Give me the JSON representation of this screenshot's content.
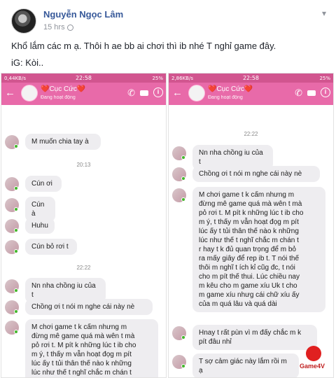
{
  "post": {
    "author": "Nguyễn Ngọc Lâm",
    "time": "15 hrs",
    "line1": "Khổ lắm các m ạ. Thôi h ae bb ai chơi thì ib nhé T nghỉ game đây.",
    "line2": "iG: Kòi.."
  },
  "phones": [
    {
      "status_left": "0,44KB/s",
      "status_time": "22:58",
      "status_right": "25%",
      "contact": "❤️Cục Cức❤️",
      "contact_status": "Đang hoạt động",
      "messages": [
        {
          "type": "msg",
          "text": "M muốn chia tay à"
        },
        {
          "type": "time",
          "text": "20:13"
        },
        {
          "type": "msg",
          "text": "Cún ơi"
        },
        {
          "type": "msg",
          "text": "Cún à"
        },
        {
          "type": "msg",
          "text": "Huhu"
        },
        {
          "type": "msg",
          "text": "Cún bỏ rơi t"
        },
        {
          "type": "time",
          "text": "22:22"
        },
        {
          "type": "msg",
          "text": "Nn nha chồng iu của t"
        },
        {
          "type": "msg",
          "text": "Chồng ơi t nói m nghe cái này nè"
        },
        {
          "type": "msg",
          "text": "M chơi game t k cấm nhưng m\nđừng mê game quá mà wên t mà\npỏ rơi t. M pít k những lúc t ib cho\nm ý, t thấy m vẫn hoạt đọg m pít\nlúc ấy t tủi thân thế nào k những\nlúc như thế t nghĩ chắc m chán t\nr hay t k đủ quan trọng để m bỏ"
        }
      ]
    },
    {
      "status_left": "2,86KB/s",
      "status_time": "22:58",
      "status_right": "25%",
      "contact": "❤️Cục Cức❤️",
      "contact_status": "Đang hoạt động",
      "messages": [
        {
          "type": "time",
          "text": "22:22"
        },
        {
          "type": "msg",
          "text": "Nn nha chồng iu của t"
        },
        {
          "type": "msg",
          "text": "Chồng ơi t nói m nghe cái này nè"
        },
        {
          "type": "msg",
          "text": "M chơi game t k cấm nhưng m\nđừng mê game quá mà wên t mà\npỏ rơi t. M pít k những lúc t ib cho\nm ý, t thấy m vẫn hoạt đọg m pít\nlúc ấy t tủi thân thế nào k những\nlúc như thế t nghĩ chắc m chán t\nr hay t k đủ quan trọng để m bỏ\nra mấy giây để rep ib t. T nói thế\nthôi m nghĩ t ích kỉ cũg đc, t nói\ncho m pít thế thui. Lúc chiều nay\nm kêu cho m game xíu Uk t cho\nm game xíu nhưg cái chữ xíu ấy\ncủa m quá lâu và quá dài"
        },
        {
          "type": "msg",
          "text": "Hnay t rất pùn vì m đấy chắc m k\npít đâu nhỉ"
        },
        {
          "type": "msg",
          "text": "T sợ cảm giác này lắm rồi m ạ"
        }
      ]
    }
  ],
  "watermark": "Game4V"
}
